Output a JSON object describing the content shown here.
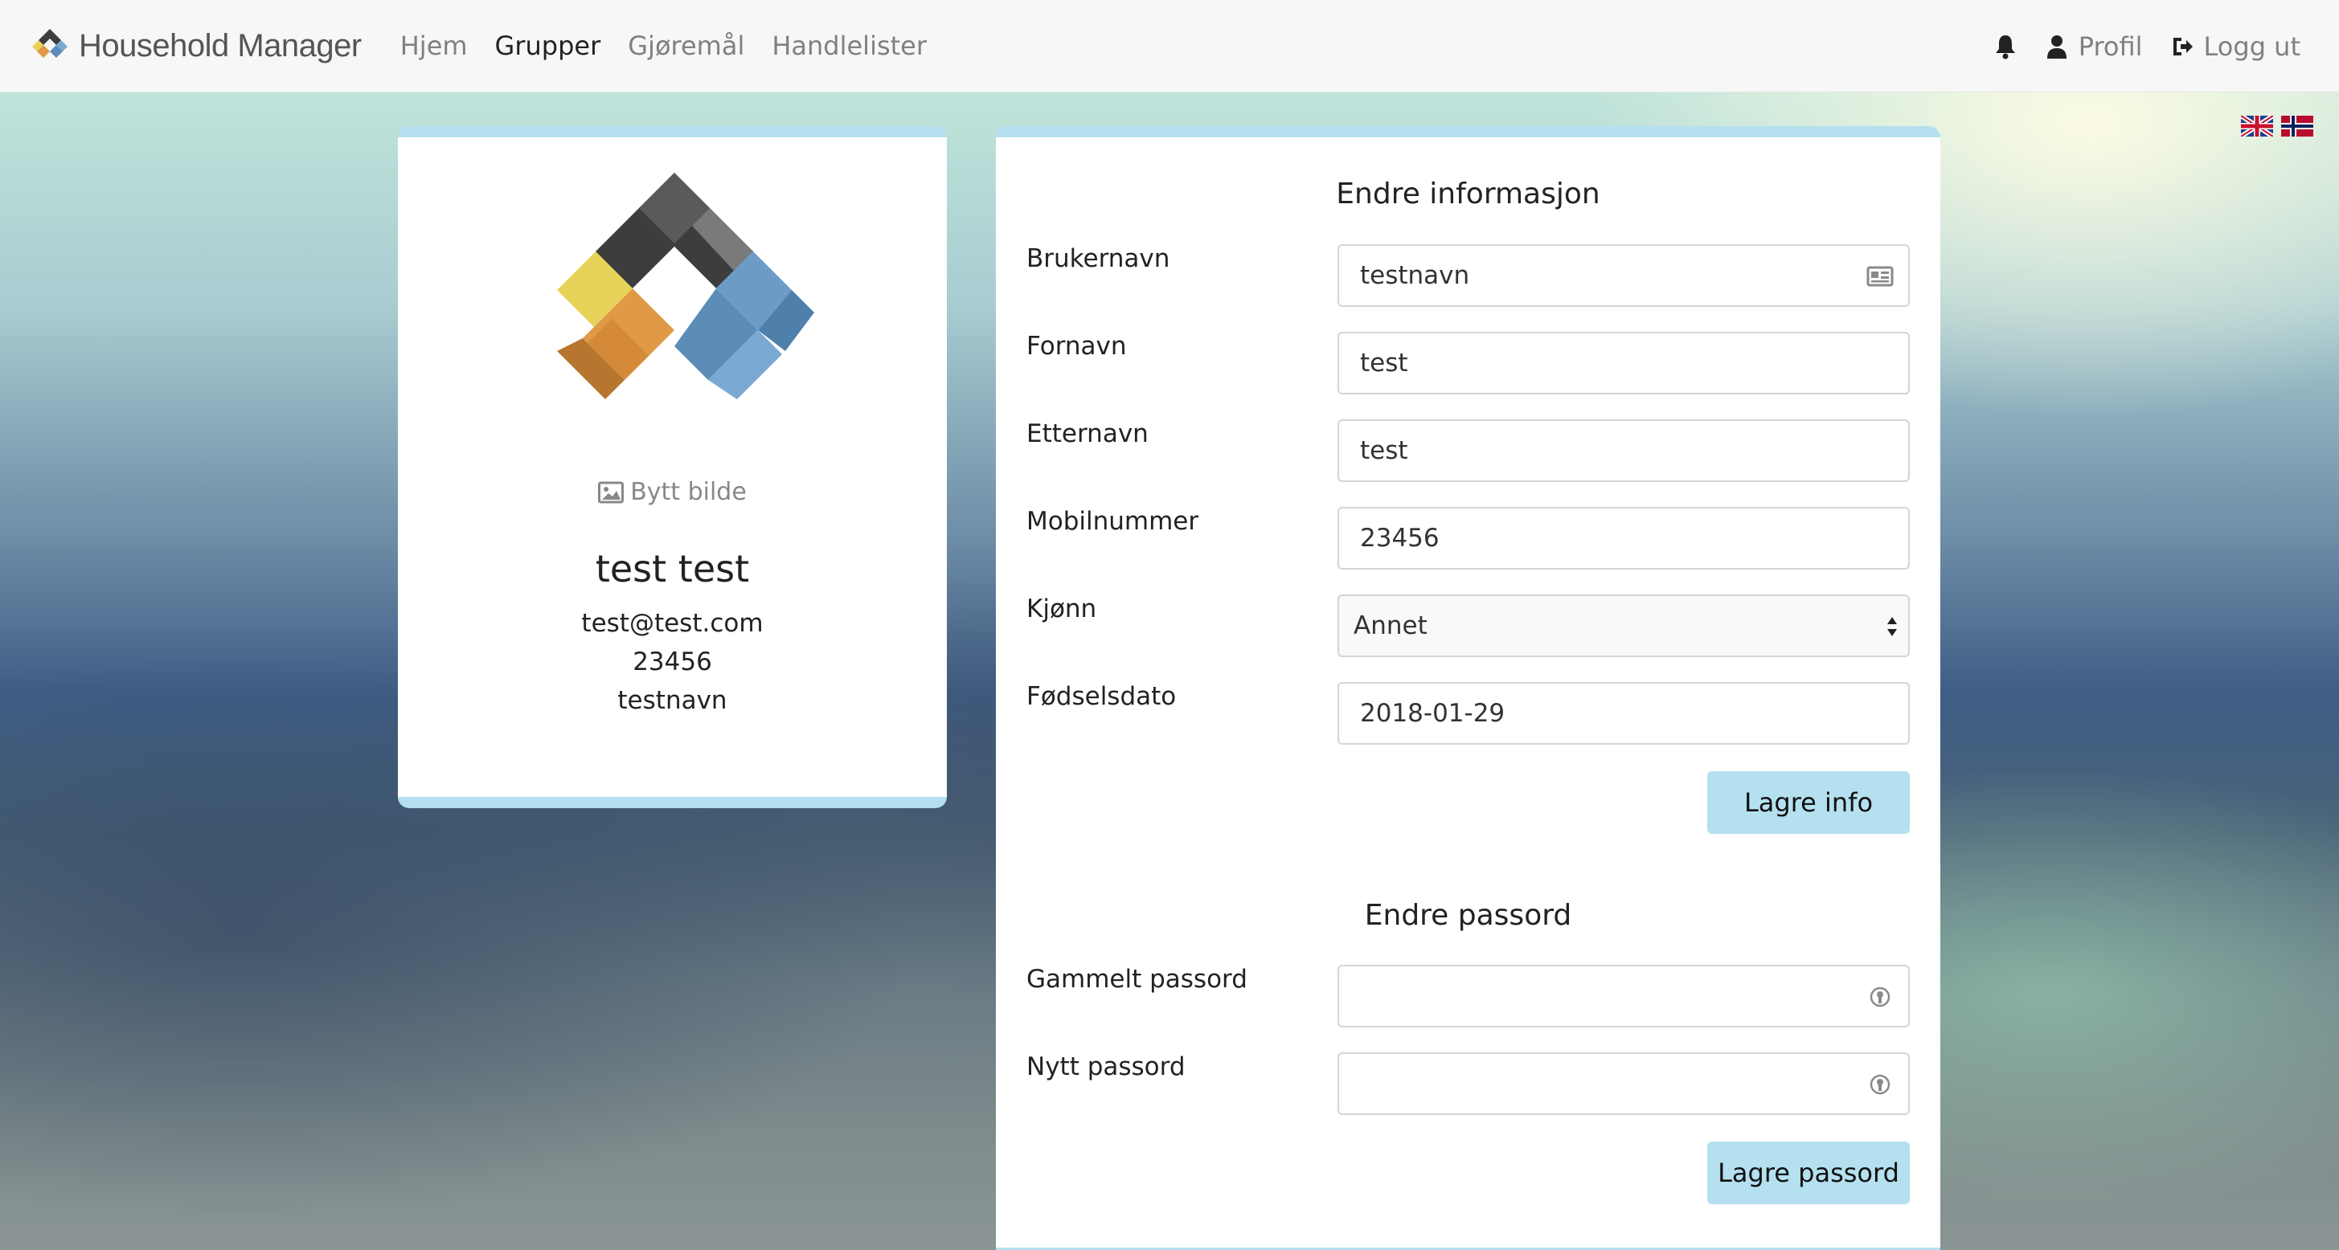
{
  "nav": {
    "brand": "Household Manager",
    "links": [
      "Hjem",
      "Grupper",
      "Gjøremål",
      "Handlelister"
    ],
    "active_index": 1,
    "profile_label": "Profil",
    "logout_label": "Logg ut"
  },
  "icons": {
    "brand": "household-logo-icon",
    "notifications": "bell-icon",
    "profile": "user-icon",
    "logout": "logout-icon",
    "change_picture": "image-icon",
    "username_field": "id-card-icon",
    "password_field": "key-icon",
    "flags": [
      "uk-flag-icon",
      "norway-flag-icon"
    ]
  },
  "profile": {
    "change_picture_label": "Bytt bilde",
    "full_name": "test test",
    "email": "test@test.com",
    "phone": "23456",
    "username": "testnavn"
  },
  "info_form": {
    "title": "Endre informasjon",
    "fields": [
      {
        "label": "Brukernavn",
        "value": "testnavn"
      },
      {
        "label": "Fornavn",
        "value": "test"
      },
      {
        "label": "Etternavn",
        "value": "test"
      },
      {
        "label": "Mobilnummer",
        "value": "23456"
      },
      {
        "label": "Kjønn",
        "value": "Annet"
      },
      {
        "label": "Fødselsdato",
        "value": "2018-01-29"
      }
    ],
    "save_label": "Lagre info"
  },
  "password_form": {
    "title": "Endre passord",
    "fields": [
      {
        "label": "Gammelt passord",
        "value": ""
      },
      {
        "label": "Nytt passord",
        "value": ""
      }
    ],
    "save_label": "Lagre passord"
  },
  "colors": {
    "accent": "#b4e0ef",
    "navbar_bg": "#f7f7f7",
    "logo_dark": "#3d3d3d",
    "logo_orange": "#e09a45",
    "logo_yellow": "#e8d35a",
    "logo_blue": "#5b8db8"
  }
}
